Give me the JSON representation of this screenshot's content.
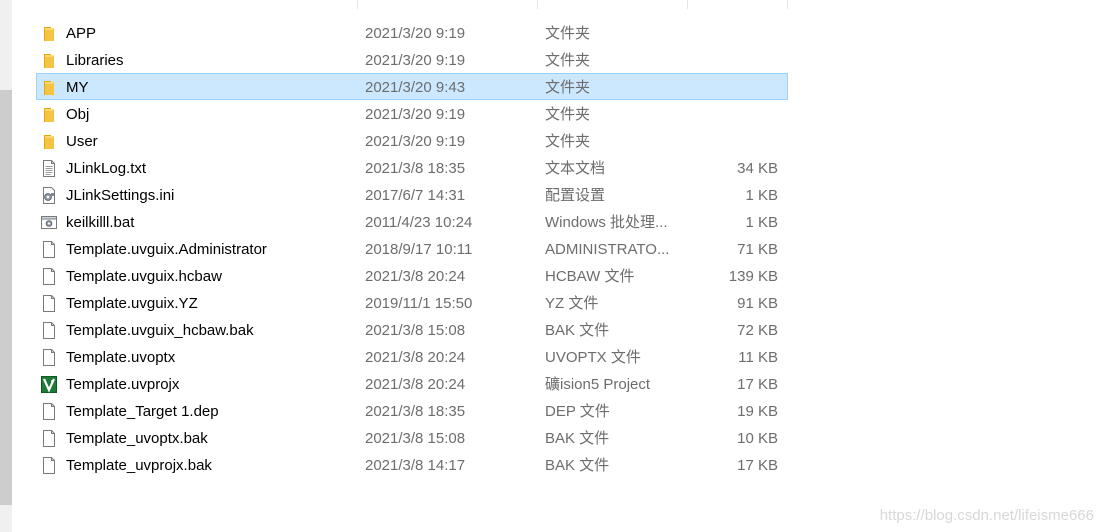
{
  "files": [
    {
      "name": "APP",
      "date": "2021/3/20 9:19",
      "type": "文件夹",
      "size": "",
      "icon": "folder-icon"
    },
    {
      "name": "Libraries",
      "date": "2021/3/20 9:19",
      "type": "文件夹",
      "size": "",
      "icon": "folder-icon"
    },
    {
      "name": "MY",
      "date": "2021/3/20 9:43",
      "type": "文件夹",
      "size": "",
      "icon": "folder-icon",
      "selected": true
    },
    {
      "name": "Obj",
      "date": "2021/3/20 9:19",
      "type": "文件夹",
      "size": "",
      "icon": "folder-icon"
    },
    {
      "name": "User",
      "date": "2021/3/20 9:19",
      "type": "文件夹",
      "size": "",
      "icon": "folder-icon"
    },
    {
      "name": "JLinkLog.txt",
      "date": "2021/3/8 18:35",
      "type": "文本文档",
      "size": "34 KB",
      "icon": "text-file-icon"
    },
    {
      "name": "JLinkSettings.ini",
      "date": "2017/6/7 14:31",
      "type": "配置设置",
      "size": "1 KB",
      "icon": "settings-file-icon"
    },
    {
      "name": "keilkilll.bat",
      "date": "2011/4/23 10:24",
      "type": "Windows 批处理...",
      "size": "1 KB",
      "icon": "batch-file-icon"
    },
    {
      "name": "Template.uvguix.Administrator",
      "date": "2018/9/17 10:11",
      "type": "ADMINISTRATO...",
      "size": "71 KB",
      "icon": "blank-file-icon"
    },
    {
      "name": "Template.uvguix.hcbaw",
      "date": "2021/3/8 20:24",
      "type": "HCBAW 文件",
      "size": "139 KB",
      "icon": "blank-file-icon"
    },
    {
      "name": "Template.uvguix.YZ",
      "date": "2019/11/1 15:50",
      "type": "YZ 文件",
      "size": "91 KB",
      "icon": "blank-file-icon"
    },
    {
      "name": "Template.uvguix_hcbaw.bak",
      "date": "2021/3/8 15:08",
      "type": "BAK 文件",
      "size": "72 KB",
      "icon": "blank-file-icon"
    },
    {
      "name": "Template.uvoptx",
      "date": "2021/3/8 20:24",
      "type": "UVOPTX 文件",
      "size": "11 KB",
      "icon": "blank-file-icon"
    },
    {
      "name": "Template.uvprojx",
      "date": "2021/3/8 20:24",
      "type": "礦ision5 Project",
      "size": "17 KB",
      "icon": "keil-project-icon"
    },
    {
      "name": "Template_Target 1.dep",
      "date": "2021/3/8 18:35",
      "type": "DEP 文件",
      "size": "19 KB",
      "icon": "blank-file-icon"
    },
    {
      "name": "Template_uvoptx.bak",
      "date": "2021/3/8 15:08",
      "type": "BAK 文件",
      "size": "10 KB",
      "icon": "blank-file-icon"
    },
    {
      "name": "Template_uvprojx.bak",
      "date": "2021/3/8 14:17",
      "type": "BAK 文件",
      "size": "17 KB",
      "icon": "blank-file-icon"
    }
  ],
  "watermark": "https://blog.csdn.net/lifeisme666",
  "colors": {
    "selection_bg": "#cce8ff",
    "selection_border": "#99d1ff",
    "folder": "#f6c445",
    "secondary_text": "#6d6d6d"
  }
}
